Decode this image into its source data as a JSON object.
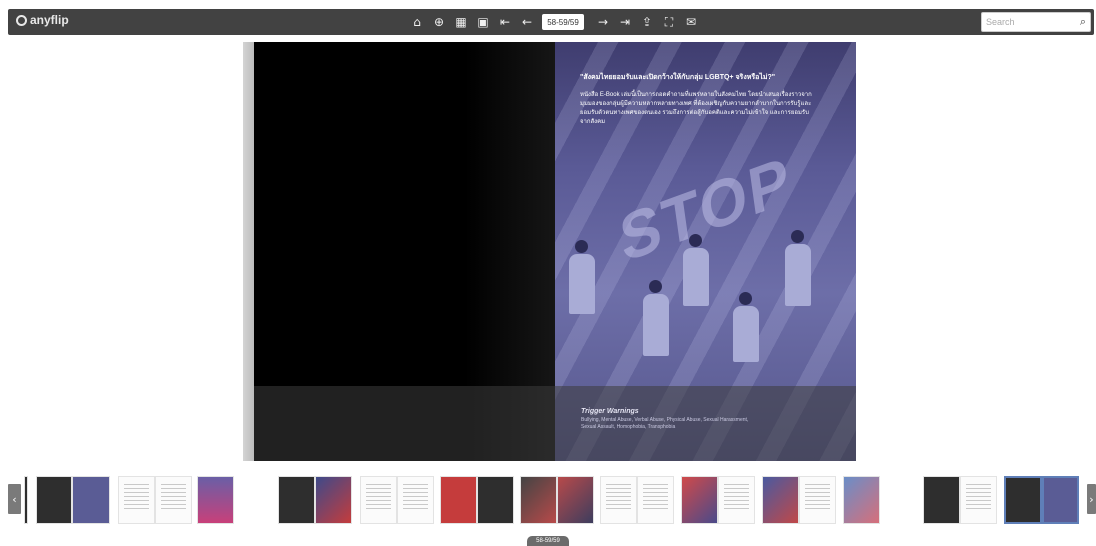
{
  "brand": {
    "logo_text": "anyflip"
  },
  "toolbar": {
    "page_indicator": "58-59/59",
    "icons": [
      "home-icon",
      "zoom-in-icon",
      "thumbnails-icon",
      "single-page-icon",
      "first-page-icon",
      "previous-page-icon",
      "next-page-icon",
      "last-page-icon",
      "share-icon",
      "fullscreen-icon",
      "email-icon"
    ]
  },
  "search": {
    "placeholder": "Search"
  },
  "page_right": {
    "title": "\"สังคมไทยยอมรับและเปิดกว้างให้กับกลุ่ม LGBTQ+ จริงหรือไม่?\"",
    "body": "หนังสือ E-Book เล่มนี้เป็นการถอดคำถามที่แพร่หลายในสังคมไทย โดยนำเสนอเรื่องราวจากมุมมองของกลุ่มผู้มีความหลากหลายทางเพศ ที่ต้องเผชิญกับความยากลำบากในการรับรู้และยอมรับตัวตนทางเพศของตนเอง รวมถึงการต่อสู้กับอคติและความไม่เข้าใจ และการยอมรับจากสังคม",
    "graphic_text": "STOP",
    "trigger_title": "Trigger Warnings",
    "trigger_body": "Bullying, Mental Abuse, Verbal Abuse, Physical Abuse, Sexual Harassment, Sexual Assault, Homophobia, Transphobia"
  },
  "thumbnails": {
    "bottom_badge": "58-59/59"
  },
  "colors": {
    "toolbar": "#424242",
    "page_blue": "#5a5a96",
    "selected_border": "#5f7fb8"
  }
}
